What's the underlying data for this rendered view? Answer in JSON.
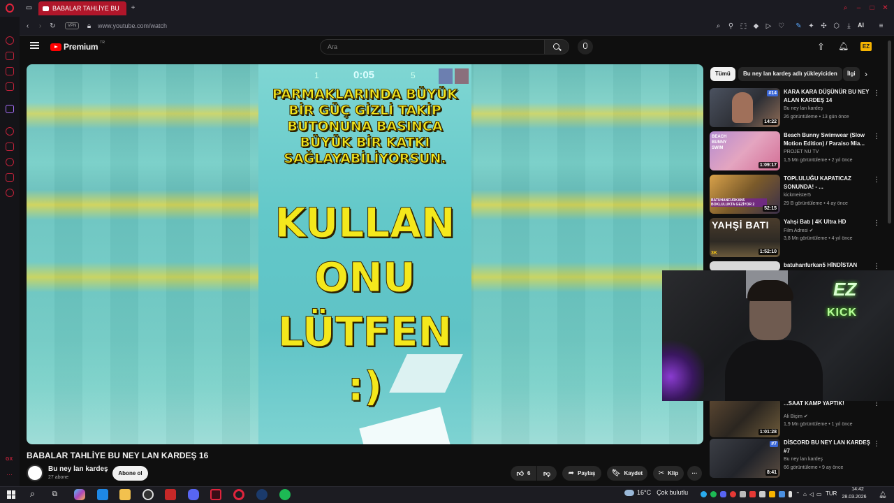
{
  "browser": {
    "tab_title": "BABALAR TAHLİYE BU",
    "url": "www.youtube.com/watch",
    "vpn_label": "VPN",
    "ai_label": "AI"
  },
  "youtube": {
    "logo_text": "Premium",
    "logo_superscript": "TR",
    "search_placeholder": "Ara",
    "accent_color": "#ff0000"
  },
  "video": {
    "short_timer": "0:05",
    "short_score_left": "1",
    "short_score_right": "5",
    "caption": "PARMAKLARINDA BÜYÜK BİR GÜÇ GİZLİ TAKİP BUTONUNA BASINCA BÜYÜK BİR KATKI SAĞLAYABİLİYORSUN.",
    "big_line1": "KULLAN",
    "big_line2": "ONU",
    "big_line3": "LÜTFEN :)",
    "title": "BABALAR TAHLİYE BU NEY LAN KARDEŞ 16",
    "channel_name": "Bu ney lan kardeş",
    "subscribers": "27 abone",
    "subscribe_label": "Abone ol",
    "likes": "6",
    "share_label": "Paylaş",
    "save_label": "Kaydet",
    "clip_label": "Klip"
  },
  "chips": [
    "Tümü",
    "Bu ney lan kardeş adlı yükleyiciden",
    "İlgi"
  ],
  "recommendations": [
    {
      "title": "KARA KARA DÜŞÜNÜR BU NEY ALAN KARDEŞ 14",
      "channel": "Bu ney lan kardeş",
      "meta": "26 görüntüleme • 13 gün önce",
      "duration": "14:22",
      "badge": "#14"
    },
    {
      "title": "Beach Bunny Swimwear (Slow Motion Edition) / Paraiso Mia...",
      "channel": "PROJET NU TV",
      "meta": "1,5 Mn görüntüleme • 2 yıl önce",
      "duration": "1:09:17",
      "thumb_text": "BEACH BUNNY SWIM"
    },
    {
      "title": "TOPLULUĞU KAPATICAZ SONUNDA! - ...",
      "channel": "kickmeister5",
      "meta": "29 B görüntüleme • 4 ay önce",
      "duration": "52:15",
      "thumb_text": "BATUHANFURKAN5 BOKLULUKTA GEZİYOR 2"
    },
    {
      "title": "Yahşi Batı | 4K Ultra HD",
      "channel": "Film Adresi",
      "meta": "3,8 Mn görüntüleme • 4 yıl önce",
      "duration": "1:52:10",
      "thumb_text": "YAHŞİ BATI",
      "thumb_badge": "3K"
    },
    {
      "title": "batuhanfurkan5 HİNDİSTAN",
      "channel": "",
      "meta": "",
      "duration": ""
    },
    {
      "title": "...SAAT KAMP YAPTIK!",
      "channel": "Ali Biçim",
      "meta": "1,9 Mn görüntüleme • 1 yıl önce",
      "duration": "1:01:28"
    },
    {
      "title": "DİSCORD BU NEY LAN KARDEŞ #7",
      "channel": "Bu ney lan kardeş",
      "meta": "66 görüntüleme • 9 ay önce",
      "duration": "8:41",
      "badge": "#7"
    }
  ],
  "webcam": {
    "logo_text": "EZ",
    "kick_text": "KICK"
  },
  "taskbar": {
    "temperature": "16°C",
    "weather": "Çok bulutlu",
    "language": "TUR",
    "time": "14:42",
    "date": "28.03.2026"
  }
}
